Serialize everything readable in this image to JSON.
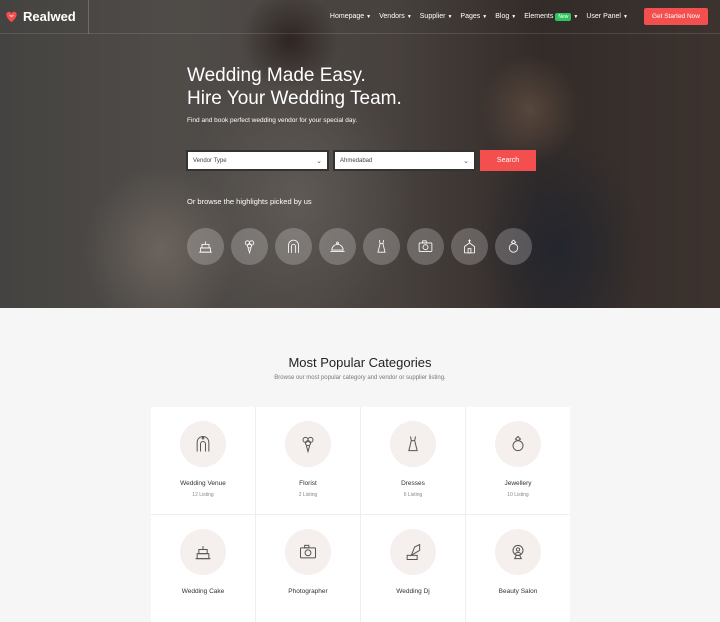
{
  "brand": {
    "name": "Realwed",
    "accent": "#f44f4f"
  },
  "nav": {
    "items": [
      {
        "label": "Homepage"
      },
      {
        "label": "Vendors"
      },
      {
        "label": "Supplier"
      },
      {
        "label": "Pages"
      },
      {
        "label": "Blog"
      },
      {
        "label": "Elements",
        "badge": "New"
      },
      {
        "label": "User Panel"
      }
    ],
    "cta": "Get Started Now"
  },
  "hero": {
    "title_line1": "Wedding Made Easy.",
    "title_line2": "Hire Your Wedding Team.",
    "subtitle": "Find and book perfect wedding vendor for your special day.",
    "vendor_select": "Vendor Type",
    "city_select": "Ahmedabad",
    "search_label": "Search",
    "browse_text": "Or browse the highlights picked by us",
    "highlight_icons": [
      "cake-icon",
      "bouquet-icon",
      "venue-arch-icon",
      "catering-icon",
      "dress-icon",
      "camera-icon",
      "chapel-icon",
      "ring-icon"
    ]
  },
  "categories": {
    "title": "Most Popular Categories",
    "subtitle": "Browse our most popular category and vendor or supplier listing.",
    "items": [
      {
        "name": "Wedding Venue",
        "count": "12 Listing",
        "icon": "venue-arch-icon"
      },
      {
        "name": "Florist",
        "count": "2 Listing",
        "icon": "bouquet-icon"
      },
      {
        "name": "Dresses",
        "count": "6 Listing",
        "icon": "dress-icon"
      },
      {
        "name": "Jewellery",
        "count": "10 Listing",
        "icon": "ring-icon"
      },
      {
        "name": "Wedding Cake",
        "count": "",
        "icon": "cake-icon"
      },
      {
        "name": "Photographer",
        "count": "",
        "icon": "camera-icon"
      },
      {
        "name": "Wedding Dj",
        "count": "",
        "icon": "gramophone-icon"
      },
      {
        "name": "Beauty Salon",
        "count": "",
        "icon": "mirror-icon"
      }
    ]
  }
}
